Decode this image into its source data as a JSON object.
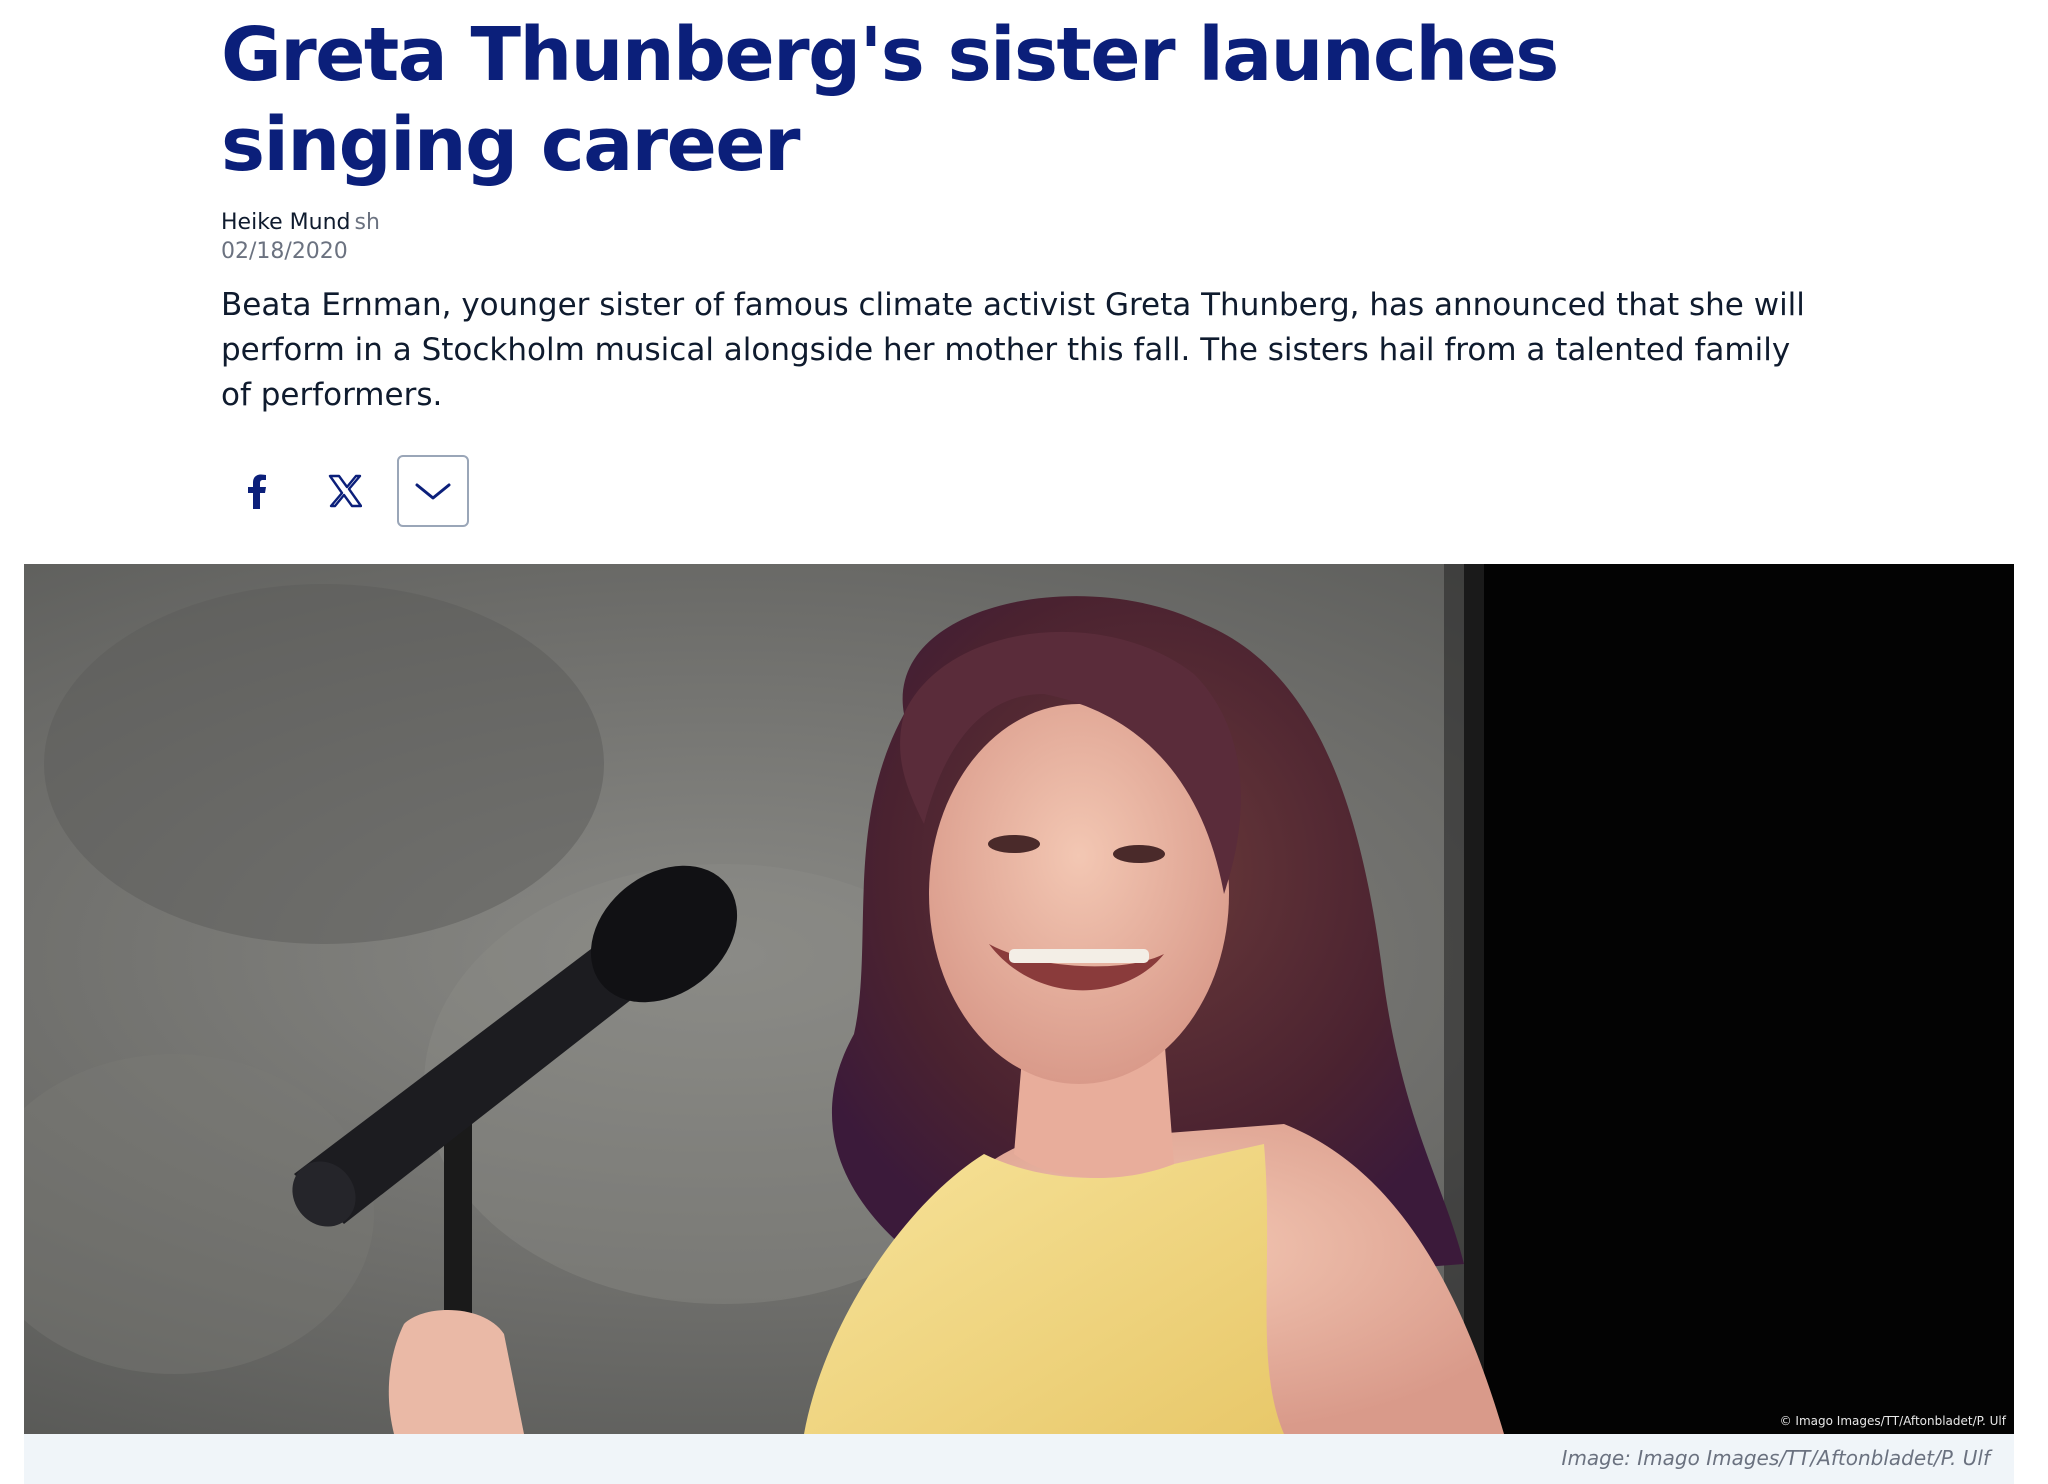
{
  "article": {
    "headline": "Greta Thunberg's sister launches singing career",
    "author": "Heike Mund",
    "author_initials": "sh",
    "date": "02/18/2020",
    "teaser": "Beata Ernman, younger sister of famous climate activist Greta Thunberg, has announced that she will perform in a Stockholm musical alongside her mother this fall. The sisters hail from a talented family of performers."
  },
  "share": {
    "buttons": [
      {
        "icon": "facebook-icon"
      },
      {
        "icon": "x-icon"
      },
      {
        "icon": "chevron-down-icon"
      }
    ]
  },
  "image": {
    "overlay_credit": "© Imago Images/TT/Aftonbladet/P. Ulf",
    "caption": "Image: Imago Images/TT/Aftonbladet/P. Ulf"
  },
  "colors": {
    "headline": "#0b1f7a",
    "text": "#0f1b2e",
    "muted": "#6b7280",
    "caption_bg": "#f0f5f9"
  }
}
